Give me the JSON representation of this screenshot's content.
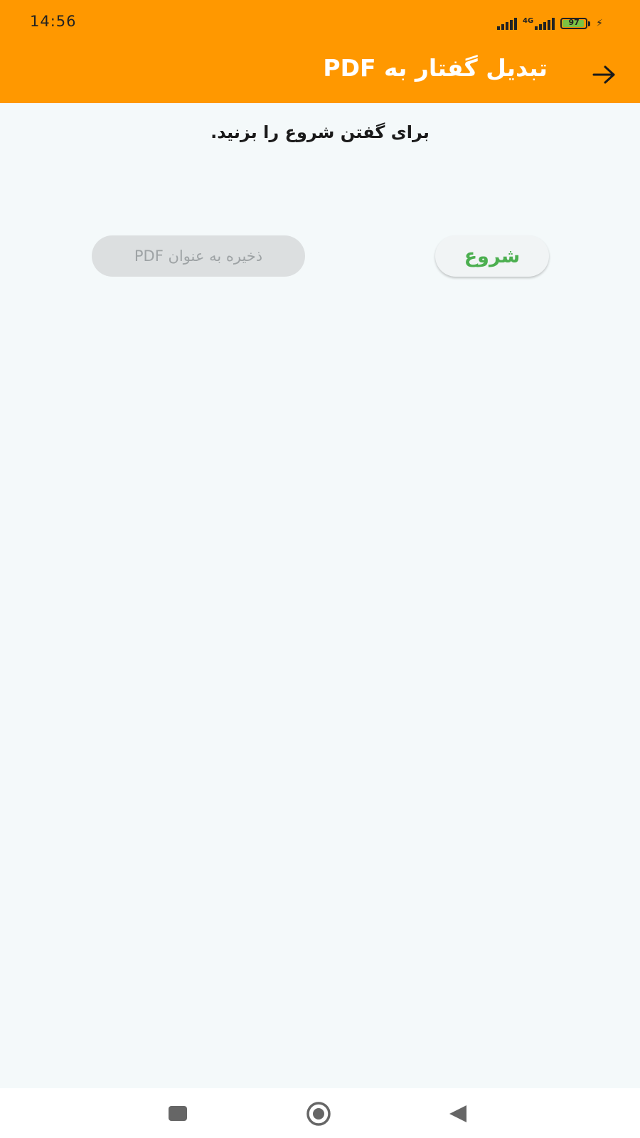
{
  "status_bar": {
    "time": "14:56",
    "network_type": "4G",
    "battery_level": "97",
    "icons": [
      "signal-icon",
      "signal-4g-icon",
      "battery-icon",
      "charging-icon"
    ]
  },
  "app_bar": {
    "title": "تبدیل گفتار به PDF",
    "back_icon": "arrow-right-icon",
    "color": "#ff9800"
  },
  "main": {
    "instruction": "برای گفتن شروع را  بزنید.",
    "start_button_label": "شروع",
    "start_button_color": "#4caf50",
    "save_pdf_button_label": "ذخیره به عنوان PDF",
    "save_pdf_button_enabled": false
  },
  "nav_bar": {
    "items": [
      "recents-icon",
      "home-icon",
      "back-icon"
    ]
  }
}
